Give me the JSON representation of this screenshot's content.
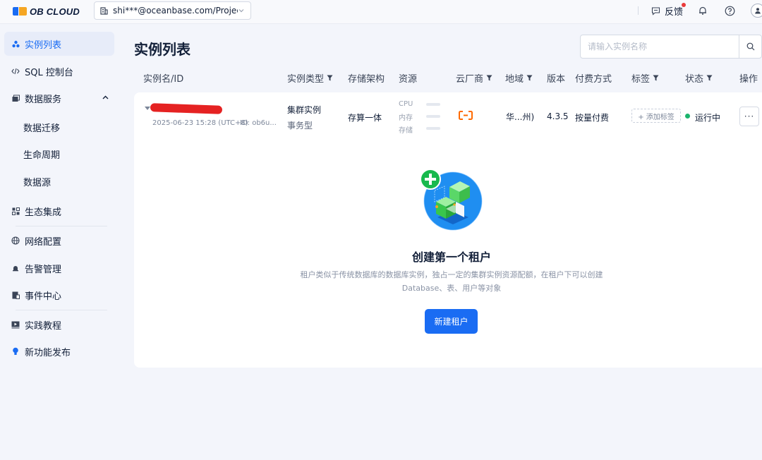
{
  "app": {
    "logo_text": "OB CLOUD",
    "project_selector": "shi***@oceanbase.com/Projec...",
    "feedback_label": "反馈"
  },
  "sidebar": {
    "items": [
      {
        "label": "实例列表",
        "icon": "instance-icon",
        "active": true
      },
      {
        "label": "SQL 控制台",
        "icon": "code-icon"
      },
      {
        "label": "数据服务",
        "icon": "data-service-icon",
        "expanded": true
      },
      {
        "label": "数据迁移"
      },
      {
        "label": "生命周期"
      },
      {
        "label": "数据源"
      },
      {
        "label": "生态集成",
        "icon": "ecosystem-icon"
      },
      {
        "label": "网络配置",
        "icon": "network-icon"
      },
      {
        "label": "告警管理",
        "icon": "alarm-icon"
      },
      {
        "label": "事件中心",
        "icon": "event-icon"
      },
      {
        "label": "实践教程",
        "icon": "tutorial-icon"
      },
      {
        "label": "新功能发布",
        "icon": "bulb-icon"
      }
    ]
  },
  "main": {
    "title": "实例列表",
    "search_placeholder": "请输入实例名称",
    "columns": [
      "实例名/ID",
      "实例类型",
      "存储架构",
      "资源",
      "云厂商",
      "地域",
      "版本",
      "付费方式",
      "标签",
      "状态",
      "操作"
    ],
    "row": {
      "created_at": "2025-06-23 15:28 (UTC+8)",
      "id_label": "ID: ob6u...",
      "type": "集群实例",
      "subtype": "事务型",
      "storage": "存算一体",
      "resources": [
        "CPU",
        "内存",
        "存储"
      ],
      "region": "华...州)",
      "version": "4.3.5",
      "billing": "按量付费",
      "add_tag": "+ 添加标签",
      "status": "运行中",
      "more": "···"
    },
    "empty": {
      "title": "创建第一个租户",
      "desc_line1": "租户类似于传统数据库的数据库实例，独占一定的集群实例资源配额，在租户下可以创建",
      "desc_line2": "Database、表、用户等对象",
      "button": "新建租户"
    }
  },
  "colors": {
    "accent": "#1a6cf3",
    "status_running": "#1bb46d",
    "cloud_vendor": "#ff6a00"
  }
}
